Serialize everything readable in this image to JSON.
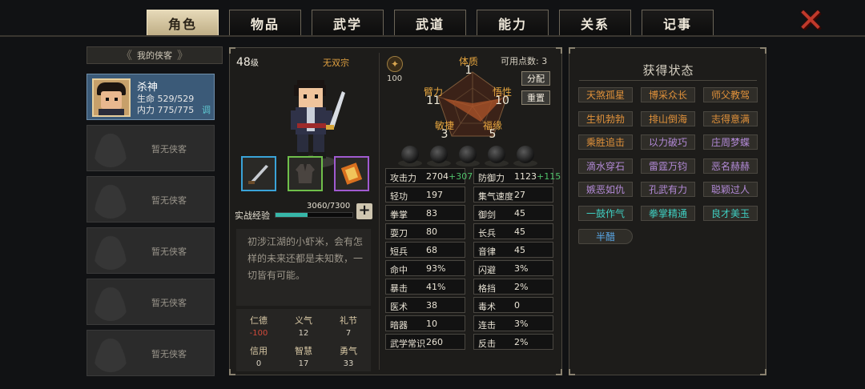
{
  "tabs": [
    "角色",
    "物品",
    "武学",
    "武道",
    "能力",
    "关系",
    "记事"
  ],
  "active_tab": 0,
  "close_icon": "close-x-icon",
  "roster": {
    "header": "我的侠客",
    "hero": {
      "name": "杀神",
      "hp": "生命 529/529",
      "mp": "内力 775/775",
      "adjust": "调"
    },
    "empty_label": "暂无侠客",
    "empty_slots": 5
  },
  "character": {
    "level_num": "48",
    "level_unit": "级",
    "sect": "无双宗",
    "xp_label": "实战经验",
    "xp_value": "3060/7300",
    "xp_progress": 0.42,
    "bio": "初涉江湖的小虾米，会有怎样的未来还都是未知数，一切皆有可能。",
    "virtues": [
      {
        "name": "仁德",
        "value": "-100",
        "neg": true
      },
      {
        "name": "义气",
        "value": "12"
      },
      {
        "name": "礼节",
        "value": "7"
      },
      {
        "name": "信用",
        "value": "0"
      },
      {
        "name": "智慧",
        "value": "17"
      },
      {
        "name": "勇气",
        "value": "33"
      }
    ]
  },
  "attributes": {
    "spirit_value": "100",
    "points_label": "可用点数: 3",
    "allocate_btn": "分配",
    "reset_btn": "重置",
    "radar": [
      {
        "name": "体质",
        "value": "1"
      },
      {
        "name": "悟性",
        "value": "10"
      },
      {
        "name": "福缘",
        "value": "5"
      },
      {
        "name": "敏捷",
        "value": "3"
      },
      {
        "name": "臂力",
        "value": "11"
      }
    ]
  },
  "stats": [
    {
      "k": "攻击力",
      "v": "2704",
      "b": "+307"
    },
    {
      "k": "防御力",
      "v": "1123",
      "b": "+115"
    },
    {
      "k": "轻功",
      "v": "197"
    },
    {
      "k": "集气速度",
      "v": "27"
    },
    {
      "k": "拳掌",
      "v": "83"
    },
    {
      "k": "御剑",
      "v": "45"
    },
    {
      "k": "耍刀",
      "v": "80"
    },
    {
      "k": "长兵",
      "v": "45"
    },
    {
      "k": "短兵",
      "v": "68"
    },
    {
      "k": "音律",
      "v": "45"
    },
    {
      "k": "命中",
      "v": "93%"
    },
    {
      "k": "闪避",
      "v": "3%"
    },
    {
      "k": "暴击",
      "v": "41%"
    },
    {
      "k": "格挡",
      "v": "2%"
    },
    {
      "k": "医术",
      "v": "38"
    },
    {
      "k": "毒术",
      "v": "0"
    },
    {
      "k": "暗器",
      "v": "10"
    },
    {
      "k": "连击",
      "v": "3%"
    },
    {
      "k": "武学常识",
      "v": "260"
    },
    {
      "k": "反击",
      "v": "2%"
    }
  ],
  "status_panel": {
    "title": "获得状态",
    "items": [
      {
        "label": "天煞孤星",
        "color": "orange"
      },
      {
        "label": "博采众长",
        "color": "orange"
      },
      {
        "label": "师父教驾",
        "color": "orange"
      },
      {
        "label": "生机勃勃",
        "color": "orange"
      },
      {
        "label": "排山倒海",
        "color": "orange"
      },
      {
        "label": "志得意满",
        "color": "orange"
      },
      {
        "label": "乘胜追击",
        "color": "orange"
      },
      {
        "label": "以力破巧",
        "color": "purple"
      },
      {
        "label": "庄周梦蝶",
        "color": "purple"
      },
      {
        "label": "滴水穿石",
        "color": "purple"
      },
      {
        "label": "雷霆万钧",
        "color": "purple"
      },
      {
        "label": "恶名赫赫",
        "color": "purple"
      },
      {
        "label": "嫉恶如仇",
        "color": "purple"
      },
      {
        "label": "孔武有力",
        "color": "purple"
      },
      {
        "label": "聪颖过人",
        "color": "purple"
      },
      {
        "label": "一鼓作气",
        "color": "teal"
      },
      {
        "label": "拳掌精通",
        "color": "teal"
      },
      {
        "label": "良才美玉",
        "color": "teal"
      },
      {
        "label": "半醋",
        "color": "blue"
      }
    ]
  }
}
